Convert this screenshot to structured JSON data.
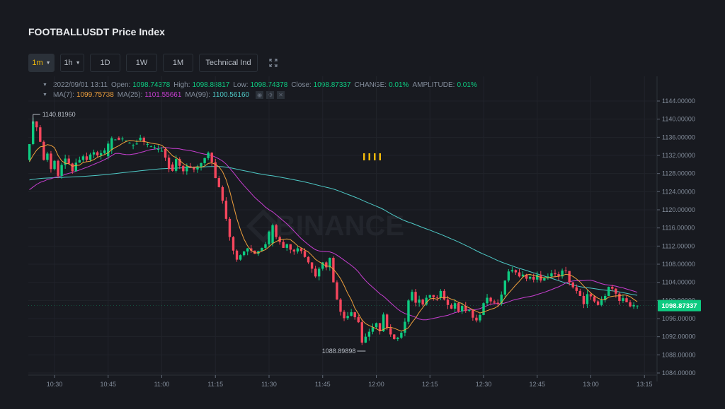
{
  "header": {
    "title": "FOOTBALLUSDT Price Index"
  },
  "toolbar": {
    "intervals": [
      {
        "label": "1m",
        "active": true,
        "dropdown": true
      },
      {
        "label": "1h",
        "active": false,
        "dropdown": true
      },
      {
        "label": "1D",
        "active": false,
        "dropdown": false
      },
      {
        "label": "1W",
        "active": false,
        "dropdown": false
      },
      {
        "label": "1M",
        "active": false,
        "dropdown": false
      }
    ],
    "technical_label": "Technical Ind",
    "expand_icon": "fullscreen-icon"
  },
  "legend": {
    "datetime": "2022/09/01 13:11",
    "open_label": "Open:",
    "open": "1098.74378",
    "high_label": "High:",
    "high": "1098.88817",
    "low_label": "Low:",
    "low": "1098.74378",
    "close_label": "Close:",
    "close": "1098.87337",
    "change_label": "CHANGE:",
    "change": "0.01%",
    "amplitude_label": "AMPLITUDE:",
    "amplitude": "0.01%",
    "ma7_label": "MA(7):",
    "ma7": "1099.75738",
    "ma25_label": "MA(25):",
    "ma25": "1101.55661",
    "ma99_label": "MA(99):",
    "ma99": "1100.56160",
    "icons": [
      "eye-icon",
      "settings-icon",
      "close-icon"
    ]
  },
  "colors": {
    "up": "#0ecb81",
    "down": "#f6465d",
    "ma7": "#f0a03c",
    "ma25": "#c83ed1",
    "ma99": "#4ec9c6",
    "accent": "#f0b90b"
  },
  "watermark": "BINANCE",
  "loading_indicator": "IIII",
  "chart_data": {
    "type": "candlestick",
    "title": "FOOTBALLUSDT Price Index",
    "interval": "1m",
    "xlabel": "",
    "ylabel": "",
    "ylim": [
      1082,
      1148
    ],
    "y_ticks": [
      "1144.00000",
      "1140.00000",
      "1136.00000",
      "1132.00000",
      "1128.00000",
      "1124.00000",
      "1120.00000",
      "1116.00000",
      "1112.00000",
      "1108.00000",
      "1104.00000",
      "1100.00000",
      "1096.00000",
      "1092.00000",
      "1088.00000",
      "1084.00000"
    ],
    "x_ticks": [
      "10:30",
      "10:45",
      "11:00",
      "11:15",
      "11:30",
      "11:45",
      "12:00",
      "12:15",
      "12:30",
      "12:45",
      "13:00",
      "13:15"
    ],
    "start_time": "10:23",
    "last_price": "1098.87337",
    "max_marker": {
      "label": "1140.81960",
      "time": "10:24"
    },
    "min_marker": {
      "label": "1088.89898",
      "time": "11:57"
    },
    "ma_periods": [
      7,
      25,
      99
    ],
    "ma_initial": {
      "ma7": 1130.0,
      "ma25": 1124.0,
      "ma99": 1126.5
    },
    "closes": [
      1134.5,
      1139.5,
      1138.2,
      1135.0,
      1131.0,
      1132.4,
      1129.0,
      1130.8,
      1127.5,
      1129.9,
      1131.3,
      1130.2,
      1128.5,
      1130.4,
      1131.0,
      1131.8,
      1131.0,
      1132.2,
      1132.7,
      1132.0,
      1132.5,
      1133.1,
      1134.6,
      1135.8,
      1135.5,
      1135.4,
      1135.7,
      1135.3,
      1134.8,
      1134.2,
      1134.6,
      1135.9,
      1135.0,
      1134.5,
      1134.0,
      1133.8,
      1133.4,
      1133.0,
      1131.5,
      1129.0,
      1128.6,
      1131.2,
      1129.7,
      1128.5,
      1129.6,
      1129.3,
      1128.9,
      1129.5,
      1130.3,
      1131.4,
      1132.6,
      1130.5,
      1127.0,
      1125.0,
      1122.0,
      1118.0,
      1114.0,
      1111.0,
      1109.0,
      1110.0,
      1110.8,
      1111.5,
      1111.0,
      1110.3,
      1110.9,
      1111.6,
      1112.4,
      1115.2,
      1116.6,
      1114.0,
      1112.9,
      1111.6,
      1112.4,
      1111.2,
      1110.8,
      1111.5,
      1110.9,
      1109.6,
      1108.4,
      1107.0,
      1105.3,
      1107.0,
      1108.4,
      1107.3,
      1109.4,
      1104.0,
      1100.2,
      1097.5,
      1096.1,
      1096.6,
      1097.4,
      1096.3,
      1095.2,
      1090.7,
      1092.0,
      1093.1,
      1094.1,
      1095.0,
      1093.2,
      1096.9,
      1093.9,
      1092.5,
      1091.5,
      1091.8,
      1092.9,
      1095.3,
      1100.0,
      1101.9,
      1099.5,
      1100.2,
      1099.1,
      1100.6,
      1101.2,
      1100.7,
      1100.6,
      1102.1,
      1100.2,
      1099.0,
      1098.2,
      1099.4,
      1097.6,
      1098.8,
      1097.7,
      1097.9,
      1096.2,
      1095.6,
      1096.8,
      1099.4,
      1100.6,
      1099.8,
      1099.5,
      1099.3,
      1101.3,
      1104.4,
      1106.4,
      1106.7,
      1106.2,
      1105.3,
      1105.7,
      1104.8,
      1105.2,
      1104.6,
      1105.7,
      1104.4,
      1104.9,
      1105.3,
      1106.0,
      1105.8,
      1105.3,
      1106.6,
      1106.5,
      1104.0,
      1102.9,
      1102.1,
      1101.0,
      1099.2,
      1101.4,
      1100.9,
      1099.8,
      1099.0,
      1100.1,
      1101.0,
      1103.0,
      1102.6,
      1101.5,
      1099.9,
      1100.5,
      1099.6,
      1098.7,
      1099.0,
      1098.87
    ],
    "opens": [
      1131.0,
      1134.5,
      1139.5,
      1138.2,
      1135.0,
      1131.0,
      1132.4,
      1129.0,
      1130.8,
      1127.5,
      1129.9,
      1131.3,
      1130.2,
      1128.5,
      1130.4,
      1131.0,
      1131.8,
      1131.0,
      1132.2,
      1132.7,
      1132.0,
      1132.5,
      1131.8,
      1133.2,
      1135.5,
      1135.9,
      1135.7,
      1135.3,
      1134.8,
      1134.2,
      1134.6,
      1135.4,
      1135.9,
      1134.5,
      1134.0,
      1133.8,
      1133.4,
      1133.0,
      1133.4,
      1131.5,
      1130.0,
      1128.6,
      1131.2,
      1129.7,
      1128.5,
      1129.6,
      1129.3,
      1128.9,
      1129.5,
      1130.3,
      1131.4,
      1132.6,
      1130.5,
      1127.0,
      1125.0,
      1122.0,
      1118.0,
      1114.0,
      1111.0,
      1109.0,
      1110.0,
      1110.8,
      1111.5,
      1111.0,
      1110.3,
      1110.9,
      1111.6,
      1112.4,
      1112.6,
      1116.6,
      1114.0,
      1112.9,
      1111.6,
      1112.4,
      1111.2,
      1110.8,
      1111.5,
      1110.9,
      1109.6,
      1108.4,
      1107.0,
      1105.3,
      1107.0,
      1108.4,
      1107.3,
      1109.4,
      1104.0,
      1100.2,
      1097.5,
      1096.1,
      1096.6,
      1097.4,
      1096.3,
      1095.2,
      1090.7,
      1092.0,
      1093.1,
      1094.1,
      1095.0,
      1093.2,
      1096.9,
      1093.9,
      1092.5,
      1091.5,
      1091.8,
      1092.9,
      1095.3,
      1100.0,
      1101.9,
      1099.5,
      1100.2,
      1099.1,
      1100.6,
      1101.2,
      1100.7,
      1100.6,
      1102.1,
      1100.2,
      1099.0,
      1098.2,
      1099.4,
      1097.6,
      1098.8,
      1097.7,
      1097.9,
      1096.2,
      1095.6,
      1096.8,
      1099.4,
      1100.6,
      1099.8,
      1099.5,
      1099.3,
      1101.3,
      1104.4,
      1106.4,
      1106.7,
      1106.2,
      1105.3,
      1105.7,
      1104.8,
      1105.2,
      1104.6,
      1105.7,
      1104.4,
      1104.9,
      1105.3,
      1106.0,
      1105.8,
      1105.3,
      1106.6,
      1106.5,
      1104.0,
      1102.9,
      1102.1,
      1101.0,
      1099.2,
      1101.4,
      1100.9,
      1099.8,
      1099.0,
      1100.1,
      1101.0,
      1103.0,
      1102.6,
      1101.5,
      1099.9,
      1100.5,
      1099.6,
      1098.7,
      1098.74
    ]
  }
}
